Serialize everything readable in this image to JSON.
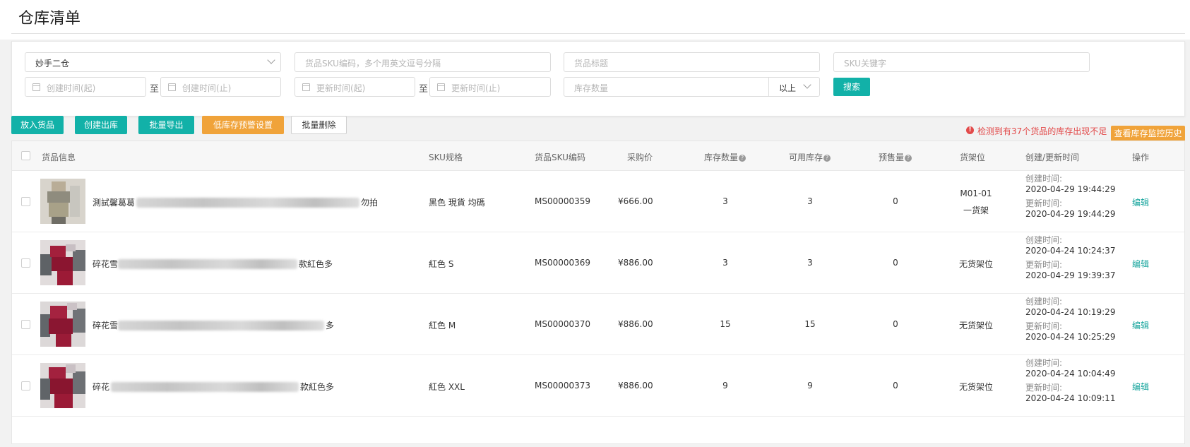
{
  "page": {
    "title": "仓库清单"
  },
  "filters": {
    "warehouse": "妙手二仓",
    "sku_code_placeholder": "货品SKU编码，多个用英文逗号分隔",
    "title_placeholder": "货品标题",
    "sku_keyword_placeholder": "SKU关键字",
    "created_from_placeholder": "创建时间(起)",
    "created_to_placeholder": "创建时间(止)",
    "updated_from_placeholder": "更新时间(起)",
    "updated_to_placeholder": "更新时间(止)",
    "range_sep": "至",
    "stock_qty_placeholder": "库存数量",
    "stock_op": "以上",
    "search_label": "搜索"
  },
  "toolbar": {
    "put_in": "放入货品",
    "create_outbound": "创建出库",
    "batch_export": "批量导出",
    "low_stock_alert": "低库存预警设置",
    "batch_delete": "批量删除",
    "warning_text": "检测到有37个货品的库存出现不足",
    "monitor_history": "查看库存监控历史"
  },
  "table": {
    "columns": {
      "info": "货品信息",
      "spec": "SKU规格",
      "sku": "货品SKU编码",
      "price": "采购价",
      "stock": "库存数量",
      "available": "可用库存",
      "presale": "预售量",
      "shelf": "货架位",
      "time": "创建/更新时间",
      "action": "操作"
    },
    "created_label": "创建时间:",
    "updated_label": "更新时间:",
    "edit_label": "编辑",
    "rows": [
      {
        "name_prefix": "測試馨葛葛",
        "name_suffix": "勿拍",
        "spec": "黑色 現貨 均碼",
        "sku": "MS00000359",
        "price": "¥666.00",
        "stock": "3",
        "available": "3",
        "presale": "0",
        "shelf_line1": "M01-01",
        "shelf_line2": "一货架",
        "created": "2020-04-29 19:44:29",
        "updated": "2020-04-29 19:44:29"
      },
      {
        "name_prefix": "碎花雪",
        "name_suffix": "款紅色多",
        "spec": "紅色 S",
        "sku": "MS00000369",
        "price": "¥886.00",
        "stock": "3",
        "available": "3",
        "presale": "0",
        "shelf_line1": "无货架位",
        "shelf_line2": "",
        "created": "2020-04-24 10:24:37",
        "updated": "2020-04-29 19:39:37"
      },
      {
        "name_prefix": "碎花雪",
        "name_suffix": "多",
        "spec": "紅色 M",
        "sku": "MS00000370",
        "price": "¥886.00",
        "stock": "15",
        "available": "15",
        "presale": "0",
        "shelf_line1": "无货架位",
        "shelf_line2": "",
        "created": "2020-04-24 10:19:29",
        "updated": "2020-04-24 10:25:29"
      },
      {
        "name_prefix": "碎花",
        "name_suffix": "款紅色多",
        "spec": "紅色 XXL",
        "sku": "MS00000373",
        "price": "¥886.00",
        "stock": "9",
        "available": "9",
        "presale": "0",
        "shelf_line1": "无货架位",
        "shelf_line2": "",
        "created": "2020-04-24 10:04:49",
        "updated": "2020-04-24 10:09:11"
      }
    ]
  },
  "colors": {
    "teal": "#12b1a8",
    "orange": "#f0a33a",
    "warn_red": "#e24a4a",
    "edit_link": "#12a39b"
  }
}
